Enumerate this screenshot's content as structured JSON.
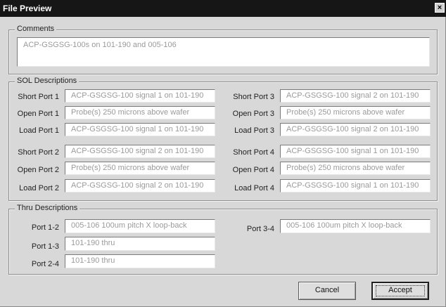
{
  "window": {
    "title": "File Preview",
    "close_glyph": "×"
  },
  "comments": {
    "group_label": "Comments",
    "value": "ACP-GSGSG-100s on 101-190 and 005-106"
  },
  "sol": {
    "group_label": "SOL Descriptions",
    "left": [
      {
        "label": "Short Port 1",
        "value": "ACP-GSGSG-100 signal 1 on 101-190"
      },
      {
        "label": "Open Port 1",
        "value": "Probe(s) 250 microns above wafer"
      },
      {
        "label": "Load Port 1",
        "value": "ACP-GSGSG-100 signal 1 on 101-190"
      },
      {
        "label": "Short Port 2",
        "value": "ACP-GSGSG-100 signal 2 on 101-190"
      },
      {
        "label": "Open Port 2",
        "value": "Probe(s) 250 microns above wafer"
      },
      {
        "label": "Load Port 2",
        "value": "ACP-GSGSG-100 signal 2 on 101-190"
      }
    ],
    "right": [
      {
        "label": "Short Port 3",
        "value": "ACP-GSGSG-100 signal 2 on 101-190"
      },
      {
        "label": "Open Port 3",
        "value": "Probe(s) 250 microns above wafer"
      },
      {
        "label": "Load Port 3",
        "value": "ACP-GSGSG-100 signal 2 on 101-190"
      },
      {
        "label": "Short Port 4",
        "value": "ACP-GSGSG-100 signal 1 on 101-190"
      },
      {
        "label": "Open Port 4",
        "value": "Probe(s) 250 microns above wafer"
      },
      {
        "label": "Load Port 4",
        "value": "ACP-GSGSG-100 signal 1 on 101-190"
      }
    ]
  },
  "thru": {
    "group_label": "Thru Descriptions",
    "left": [
      {
        "label": "Port 1-2",
        "value": "005-106 100um pitch X loop-back"
      },
      {
        "label": "Port 1-3",
        "value": "101-190 thru"
      },
      {
        "label": "Port 2-4",
        "value": "101-190 thru"
      }
    ],
    "right": [
      {
        "label": "Port 3-4",
        "value": "005-106 100um pitch X loop-back"
      }
    ]
  },
  "buttons": {
    "cancel": "Cancel",
    "accept": "Accept"
  }
}
